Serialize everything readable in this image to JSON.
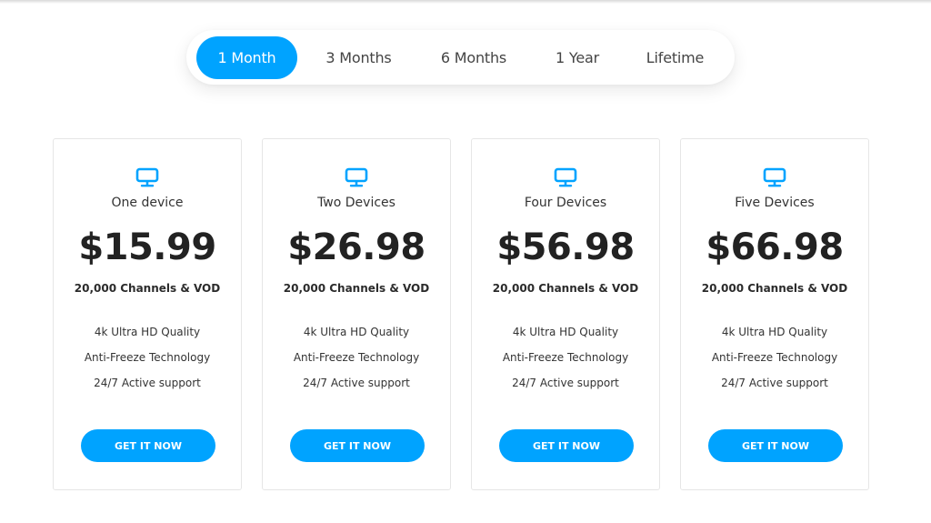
{
  "accent_color": "#00a3ff",
  "period_tabs": {
    "active_index": 0,
    "items": [
      {
        "label": "1 Month"
      },
      {
        "label": "3 Months"
      },
      {
        "label": "6 Months"
      },
      {
        "label": "1 Year"
      },
      {
        "label": "Lifetime"
      }
    ]
  },
  "plans": [
    {
      "icon": "monitor-icon",
      "name": "One device",
      "price": "$15.99",
      "channels": "20,000 Channels & VOD",
      "features": [
        "4k Ultra HD Quality",
        "Anti-Freeze Technology",
        "24/7 Active support"
      ],
      "cta_label": "GET IT NOW"
    },
    {
      "icon": "monitor-icon",
      "name": "Two Devices",
      "price": "$26.98",
      "channels": "20,000 Channels & VOD",
      "features": [
        "4k Ultra HD Quality",
        "Anti-Freeze Technology",
        "24/7 Active support"
      ],
      "cta_label": "GET IT NOW"
    },
    {
      "icon": "monitor-icon",
      "name": "Four Devices",
      "price": "$56.98",
      "channels": "20,000 Channels & VOD",
      "features": [
        "4k Ultra HD Quality",
        "Anti-Freeze Technology",
        "24/7 Active support"
      ],
      "cta_label": "GET IT NOW"
    },
    {
      "icon": "monitor-icon",
      "name": "Five Devices",
      "price": "$66.98",
      "channels": "20,000 Channels & VOD",
      "features": [
        "4k Ultra HD Quality",
        "Anti-Freeze Technology",
        "24/7 Active support"
      ],
      "cta_label": "GET IT NOW"
    }
  ]
}
